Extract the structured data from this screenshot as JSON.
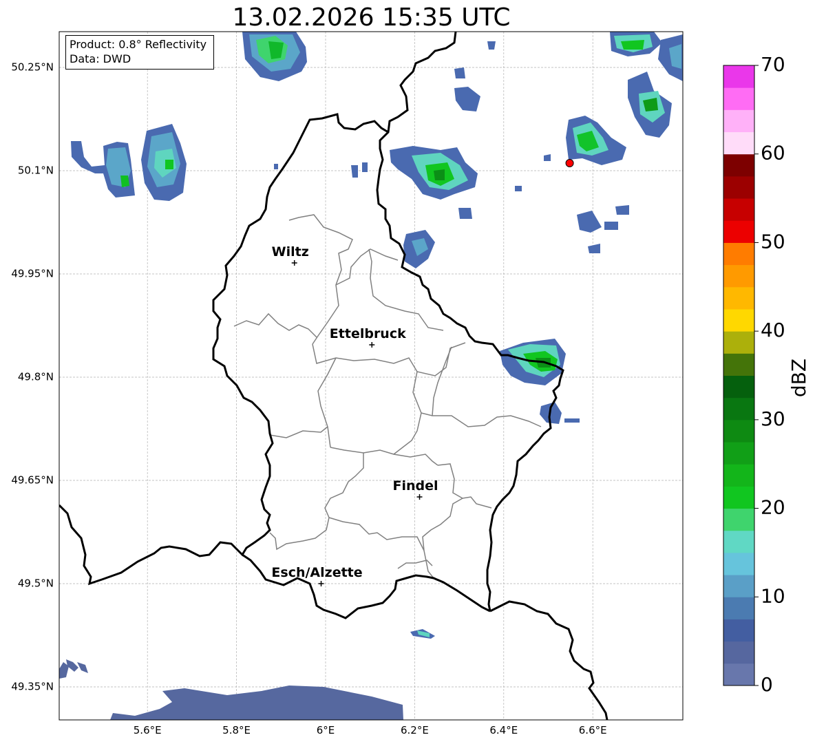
{
  "title": "13.02.2026 15:35 UTC",
  "info": {
    "product": "Product: 0.8° Reflectivity",
    "data": "Data: DWD"
  },
  "axes": {
    "lat_ticks": [
      "50.25°N",
      "50.1°N",
      "49.95°N",
      "49.8°N",
      "49.65°N",
      "49.5°N",
      "49.35°N"
    ],
    "lon_ticks": [
      "5.6°E",
      "5.8°E",
      "6°E",
      "6.2°E",
      "6.4°E",
      "6.6°E"
    ]
  },
  "cities": [
    {
      "name": "Wiltz",
      "lon": 5.93,
      "lat": 49.966
    },
    {
      "name": "Ettelbruck",
      "lon": 6.104,
      "lat": 49.847
    },
    {
      "name": "Findel",
      "lon": 6.211,
      "lat": 49.626
    },
    {
      "name": "Esch/Alzette",
      "lon": 5.99,
      "lat": 49.5
    }
  ],
  "radar_site": {
    "lon": 6.548,
    "lat": 50.111,
    "color": "#ff0000"
  },
  "colorbar": {
    "label": "dBZ",
    "ticks": [
      "0",
      "10",
      "20",
      "30",
      "40",
      "50",
      "60",
      "70"
    ],
    "colors": [
      "#6877ac",
      "#56679f",
      "#435ea1",
      "#4b7bb1",
      "#5a9fc7",
      "#66c4dc",
      "#60d8c4",
      "#3fd46d",
      "#11c620",
      "#13b51a",
      "#119f17",
      "#0e8a12",
      "#097711",
      "#05600d",
      "#447409",
      "#acb00b",
      "#ffd800",
      "#ffb800",
      "#ff9a00",
      "#ff7c00",
      "#ec0000",
      "#c70000",
      "#9c0000",
      "#7d0000",
      "#ffdcf9",
      "#ffb1f8",
      "#ff6cf4",
      "#ea37ea"
    ]
  }
}
